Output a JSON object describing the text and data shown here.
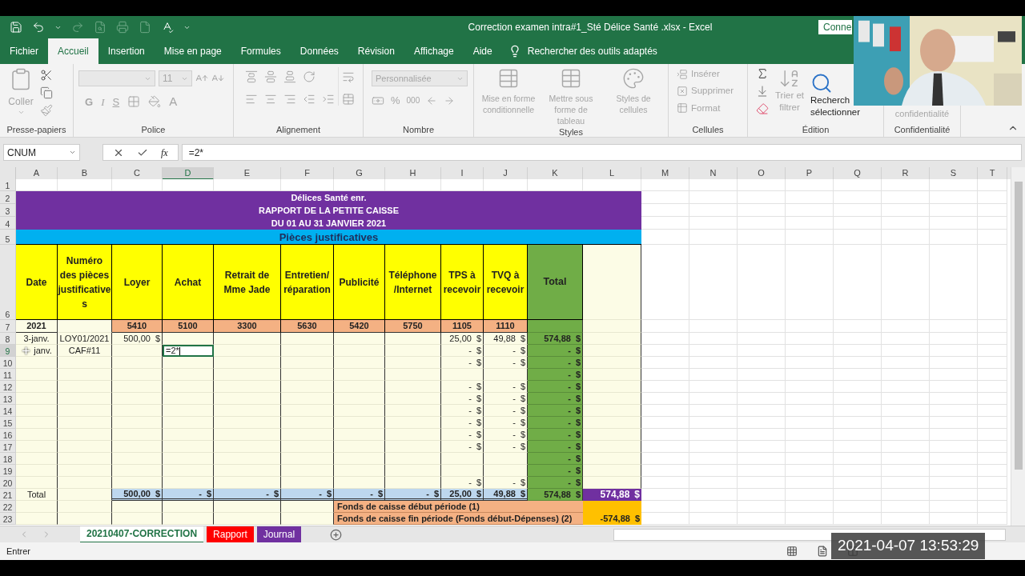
{
  "window": {
    "title": "Correction examen intra#1_Sté Délice Santé .xlsx  -  Excel",
    "connect_button": "Conne"
  },
  "menu_tabs": [
    {
      "label": "Fichier",
      "selected": false
    },
    {
      "label": "Accueil",
      "selected": true
    },
    {
      "label": "Insertion",
      "selected": false
    },
    {
      "label": "Mise en page",
      "selected": false
    },
    {
      "label": "Formules",
      "selected": false
    },
    {
      "label": "Données",
      "selected": false
    },
    {
      "label": "Révision",
      "selected": false
    },
    {
      "label": "Affichage",
      "selected": false
    },
    {
      "label": "Aide",
      "selected": false
    }
  ],
  "tell_me": "Rechercher des outils adaptés",
  "ribbon": {
    "groups": [
      {
        "kind": "clipboard",
        "label": "Presse-papiers",
        "paste": "Coller"
      },
      {
        "kind": "font",
        "label": "Police",
        "size": "11",
        "bold": "G",
        "italic": "I",
        "underline": "S",
        "font_color": "A"
      },
      {
        "kind": "alignment",
        "label": "Alignement"
      },
      {
        "kind": "number",
        "label": "Nombre",
        "format": "Personnalisée",
        "percent": "%",
        "thousands": "000"
      },
      {
        "kind": "styles",
        "label": "Styles",
        "buttons": [
          "Mise en forme conditionnelle",
          "Mettre sous forme de tableau",
          "Styles de cellules"
        ]
      },
      {
        "kind": "cells",
        "label": "Cellules",
        "buttons": [
          "Insérer",
          "Supprimer",
          "Format"
        ]
      },
      {
        "kind": "editing",
        "label": "Édition",
        "sort": "Trier et filtrer",
        "find": [
          "Recherch",
          "sélectionner"
        ]
      },
      {
        "kind": "privacy",
        "label": "Confidentialité",
        "button": "confidentialité"
      }
    ]
  },
  "formula_bar": {
    "name_box": "CNUM",
    "fx": "fx",
    "formula": "=2*"
  },
  "columns": [
    {
      "label": "A",
      "selected": false
    },
    {
      "label": "B",
      "selected": false
    },
    {
      "label": "C",
      "selected": false
    },
    {
      "label": "D",
      "selected": true
    },
    {
      "label": "E",
      "selected": false
    },
    {
      "label": "F",
      "selected": false
    },
    {
      "label": "G",
      "selected": false
    },
    {
      "label": "H",
      "selected": false
    },
    {
      "label": "I",
      "selected": false
    },
    {
      "label": "J",
      "selected": false
    },
    {
      "label": "K",
      "selected": false
    },
    {
      "label": "L",
      "selected": false
    },
    {
      "label": "M",
      "selected": false
    },
    {
      "label": "N",
      "selected": false
    },
    {
      "label": "O",
      "selected": false
    },
    {
      "label": "P",
      "selected": false
    },
    {
      "label": "Q",
      "selected": false
    },
    {
      "label": "R",
      "selected": false
    },
    {
      "label": "S",
      "selected": false
    },
    {
      "label": "T",
      "selected": false
    }
  ],
  "rows": [
    {
      "number": "1",
      "selected": false,
      "kind": "blank"
    },
    {
      "number": "2",
      "selected": false,
      "kind": "title",
      "text": "Délices Santé enr."
    },
    {
      "number": "3",
      "selected": false,
      "kind": "title",
      "text": "RAPPORT DE LA PETITE CAISSE"
    },
    {
      "number": "4",
      "selected": false,
      "kind": "title",
      "text": "DU 01 AU 31 JANVIER 2021"
    },
    {
      "number": "5",
      "selected": false,
      "kind": "band",
      "text": "Pièces justificatives"
    },
    {
      "number": "6",
      "selected": false,
      "kind": "table",
      "cells": [
        {
          "kind": "head",
          "text": "Date"
        },
        {
          "kind": "head",
          "text": "Numéro des pièces justificatives"
        },
        {
          "kind": "head",
          "text": "Loyer"
        },
        {
          "kind": "head",
          "text": "Achat"
        },
        {
          "kind": "head",
          "text": "Retrait de Mme Jade"
        },
        {
          "kind": "head",
          "text": "Entretien/ réparation"
        },
        {
          "kind": "head",
          "text": "Publicité"
        },
        {
          "kind": "head",
          "text": "Téléphone /Internet"
        },
        {
          "kind": "head",
          "text": "TPS à recevoir"
        },
        {
          "kind": "head",
          "text": "TVQ à recevoir"
        },
        {
          "kind": "head_total",
          "text": "Total"
        },
        {
          "kind": "pale"
        }
      ]
    },
    {
      "number": "7",
      "selected": false,
      "kind": "table",
      "cells": [
        {
          "kind": "year",
          "text": "2021"
        },
        {
          "kind": "pale"
        },
        {
          "kind": "code",
          "text": "5410"
        },
        {
          "kind": "code",
          "text": "5100"
        },
        {
          "kind": "code",
          "text": "3300"
        },
        {
          "kind": "code",
          "text": "5630"
        },
        {
          "kind": "code",
          "text": "5420"
        },
        {
          "kind": "code",
          "text": "5750"
        },
        {
          "kind": "code",
          "text": "1105"
        },
        {
          "kind": "code",
          "text": "1110"
        },
        {
          "kind": "green"
        },
        {
          "kind": "pale"
        }
      ]
    },
    {
      "number": "8",
      "selected": false,
      "kind": "table",
      "cells": [
        {
          "kind": "pale",
          "text": "3-janv."
        },
        {
          "kind": "pale",
          "text": "LOY01/2021"
        },
        {
          "kind": "num",
          "value": "500,00",
          "unit": "$"
        },
        {
          "kind": "pale"
        },
        {
          "kind": "pale"
        },
        {
          "kind": "pale"
        },
        {
          "kind": "pale"
        },
        {
          "kind": "pale"
        },
        {
          "kind": "num",
          "value": "25,00",
          "unit": "$"
        },
        {
          "kind": "num",
          "value": "49,88",
          "unit": "$"
        },
        {
          "kind": "green",
          "value": "574,88",
          "unit": "$"
        },
        {
          "kind": "pale"
        }
      ]
    },
    {
      "number": "9",
      "selected": true,
      "kind": "table",
      "cells": [
        {
          "kind": "pale",
          "text": "janv.",
          "pointer": true
        },
        {
          "kind": "pale",
          "text": "CAF#11"
        },
        {
          "kind": "pale"
        },
        {
          "kind": "edit",
          "text": "=2*"
        },
        {
          "kind": "pale"
        },
        {
          "kind": "pale"
        },
        {
          "kind": "pale"
        },
        {
          "kind": "pale"
        },
        {
          "kind": "num",
          "value": "-",
          "unit": "$"
        },
        {
          "kind": "num",
          "value": "-",
          "unit": "$"
        },
        {
          "kind": "green",
          "value": "-",
          "unit": "$"
        },
        {
          "kind": "pale"
        }
      ]
    },
    {
      "number": "10",
      "selected": false,
      "kind": "table",
      "cells": [
        {
          "kind": "pale"
        },
        {
          "kind": "pale"
        },
        {
          "kind": "pale"
        },
        {
          "kind": "pale"
        },
        {
          "kind": "pale"
        },
        {
          "kind": "pale"
        },
        {
          "kind": "pale"
        },
        {
          "kind": "pale"
        },
        {
          "kind": "num",
          "value": "-",
          "unit": "$"
        },
        {
          "kind": "num",
          "value": "-",
          "unit": "$"
        },
        {
          "kind": "green",
          "value": "-",
          "unit": "$"
        },
        {
          "kind": "pale"
        }
      ]
    },
    {
      "number": "11",
      "selected": false,
      "kind": "table",
      "cells": [
        {
          "kind": "pale"
        },
        {
          "kind": "pale"
        },
        {
          "kind": "pale"
        },
        {
          "kind": "pale"
        },
        {
          "kind": "pale"
        },
        {
          "kind": "pale"
        },
        {
          "kind": "pale"
        },
        {
          "kind": "pale"
        },
        {
          "kind": "pale"
        },
        {
          "kind": "pale"
        },
        {
          "kind": "green",
          "value": "-",
          "unit": "$"
        },
        {
          "kind": "pale"
        }
      ]
    },
    {
      "number": "12",
      "selected": false,
      "kind": "table",
      "cells": [
        {
          "kind": "pale"
        },
        {
          "kind": "pale"
        },
        {
          "kind": "pale"
        },
        {
          "kind": "pale"
        },
        {
          "kind": "pale"
        },
        {
          "kind": "pale"
        },
        {
          "kind": "pale"
        },
        {
          "kind": "pale"
        },
        {
          "kind": "num",
          "value": "-",
          "unit": "$"
        },
        {
          "kind": "num",
          "value": "-",
          "unit": "$"
        },
        {
          "kind": "green",
          "value": "-",
          "unit": "$"
        },
        {
          "kind": "pale"
        }
      ]
    },
    {
      "number": "13",
      "selected": false,
      "kind": "table",
      "cells": [
        {
          "kind": "pale"
        },
        {
          "kind": "pale"
        },
        {
          "kind": "pale"
        },
        {
          "kind": "pale"
        },
        {
          "kind": "pale"
        },
        {
          "kind": "pale"
        },
        {
          "kind": "pale"
        },
        {
          "kind": "pale"
        },
        {
          "kind": "num",
          "value": "-",
          "unit": "$"
        },
        {
          "kind": "num",
          "value": "-",
          "unit": "$"
        },
        {
          "kind": "green",
          "value": "-",
          "unit": "$"
        },
        {
          "kind": "pale"
        }
      ]
    },
    {
      "number": "14",
      "selected": false,
      "kind": "table",
      "cells": [
        {
          "kind": "pale"
        },
        {
          "kind": "pale"
        },
        {
          "kind": "pale"
        },
        {
          "kind": "pale"
        },
        {
          "kind": "pale"
        },
        {
          "kind": "pale"
        },
        {
          "kind": "pale"
        },
        {
          "kind": "pale"
        },
        {
          "kind": "num",
          "value": "-",
          "unit": "$"
        },
        {
          "kind": "num",
          "value": "-",
          "unit": "$"
        },
        {
          "kind": "green",
          "value": "-",
          "unit": "$"
        },
        {
          "kind": "pale"
        }
      ]
    },
    {
      "number": "15",
      "selected": false,
      "kind": "table",
      "cells": [
        {
          "kind": "pale"
        },
        {
          "kind": "pale"
        },
        {
          "kind": "pale"
        },
        {
          "kind": "pale"
        },
        {
          "kind": "pale"
        },
        {
          "kind": "pale"
        },
        {
          "kind": "pale"
        },
        {
          "kind": "pale"
        },
        {
          "kind": "num",
          "value": "-",
          "unit": "$"
        },
        {
          "kind": "num",
          "value": "-",
          "unit": "$"
        },
        {
          "kind": "green",
          "value": "-",
          "unit": "$"
        },
        {
          "kind": "pale"
        }
      ]
    },
    {
      "number": "16",
      "selected": false,
      "kind": "table",
      "cells": [
        {
          "kind": "pale"
        },
        {
          "kind": "pale"
        },
        {
          "kind": "pale"
        },
        {
          "kind": "pale"
        },
        {
          "kind": "pale"
        },
        {
          "kind": "pale"
        },
        {
          "kind": "pale"
        },
        {
          "kind": "pale"
        },
        {
          "kind": "num",
          "value": "-",
          "unit": "$"
        },
        {
          "kind": "num",
          "value": "-",
          "unit": "$"
        },
        {
          "kind": "green",
          "value": "-",
          "unit": "$"
        },
        {
          "kind": "pale"
        }
      ]
    },
    {
      "number": "17",
      "selected": false,
      "kind": "table",
      "cells": [
        {
          "kind": "pale"
        },
        {
          "kind": "pale"
        },
        {
          "kind": "pale"
        },
        {
          "kind": "pale"
        },
        {
          "kind": "pale"
        },
        {
          "kind": "pale"
        },
        {
          "kind": "pale"
        },
        {
          "kind": "pale"
        },
        {
          "kind": "num",
          "value": "-",
          "unit": "$"
        },
        {
          "kind": "num",
          "value": "-",
          "unit": "$"
        },
        {
          "kind": "green",
          "value": "-",
          "unit": "$"
        },
        {
          "kind": "pale"
        }
      ]
    },
    {
      "number": "18",
      "selected": false,
      "kind": "table",
      "cells": [
        {
          "kind": "pale"
        },
        {
          "kind": "pale"
        },
        {
          "kind": "pale"
        },
        {
          "kind": "pale"
        },
        {
          "kind": "pale"
        },
        {
          "kind": "pale"
        },
        {
          "kind": "pale"
        },
        {
          "kind": "pale"
        },
        {
          "kind": "pale"
        },
        {
          "kind": "pale"
        },
        {
          "kind": "green",
          "value": "-",
          "unit": "$"
        },
        {
          "kind": "pale"
        }
      ]
    },
    {
      "number": "19",
      "selected": false,
      "kind": "table",
      "cells": [
        {
          "kind": "pale"
        },
        {
          "kind": "pale"
        },
        {
          "kind": "pale"
        },
        {
          "kind": "pale"
        },
        {
          "kind": "pale"
        },
        {
          "kind": "pale"
        },
        {
          "kind": "pale"
        },
        {
          "kind": "pale"
        },
        {
          "kind": "pale"
        },
        {
          "kind": "pale"
        },
        {
          "kind": "green",
          "value": "-",
          "unit": "$"
        },
        {
          "kind": "pale"
        }
      ]
    },
    {
      "number": "20",
      "selected": false,
      "kind": "table",
      "cells": [
        {
          "kind": "pale"
        },
        {
          "kind": "pale"
        },
        {
          "kind": "pale"
        },
        {
          "kind": "pale"
        },
        {
          "kind": "pale"
        },
        {
          "kind": "pale"
        },
        {
          "kind": "pale"
        },
        {
          "kind": "pale"
        },
        {
          "kind": "num",
          "value": "-",
          "unit": "$"
        },
        {
          "kind": "num",
          "value": "-",
          "unit": "$"
        },
        {
          "kind": "green",
          "value": "-",
          "unit": "$"
        },
        {
          "kind": "pale"
        }
      ]
    },
    {
      "number": "21",
      "selected": false,
      "kind": "table",
      "cells": [
        {
          "kind": "pale",
          "text": "Total"
        },
        {
          "kind": "pale"
        },
        {
          "kind": "sum",
          "value": "500,00",
          "unit": "$"
        },
        {
          "kind": "sum",
          "value": "-",
          "unit": "$"
        },
        {
          "kind": "sum",
          "value": "-",
          "unit": "$"
        },
        {
          "kind": "sum",
          "value": "-",
          "unit": "$"
        },
        {
          "kind": "sum",
          "value": "-",
          "unit": "$"
        },
        {
          "kind": "sum",
          "value": "-",
          "unit": "$"
        },
        {
          "kind": "sum",
          "value": "25,00",
          "unit": "$"
        },
        {
          "kind": "sum",
          "value": "49,88",
          "unit": "$"
        },
        {
          "kind": "green",
          "value": "574,88",
          "unit": "$"
        },
        {
          "kind": "grand",
          "value": "574,88",
          "unit": "$"
        }
      ]
    },
    {
      "number": "22",
      "selected": false,
      "kind": "table",
      "cells": [
        {
          "kind": "pale"
        },
        {
          "kind": "pale"
        },
        {
          "kind": "pale"
        },
        {
          "kind": "pale"
        },
        {
          "kind": "pale"
        },
        {
          "kind": "pale"
        },
        {
          "kind": "fund",
          "text": "Fonds de caisse début période (1)"
        },
        {
          "kind": "fund_value"
        }
      ]
    },
    {
      "number": "23",
      "selected": false,
      "kind": "table",
      "cells": [
        {
          "kind": "pale"
        },
        {
          "kind": "pale"
        },
        {
          "kind": "pale"
        },
        {
          "kind": "pale"
        },
        {
          "kind": "pale"
        },
        {
          "kind": "pale"
        },
        {
          "kind": "fund",
          "text": "Fonds de caisse fin période (Fonds début-Dépenses) (2)"
        },
        {
          "kind": "fund_value",
          "value": "-574,88",
          "unit": "$"
        }
      ]
    }
  ],
  "sheet_tabs": [
    {
      "label": "20210407-CORRECTION",
      "selected": true,
      "color": "#ffffff"
    },
    {
      "label": "Rapport",
      "selected": false,
      "color": "#ff0000"
    },
    {
      "label": "Journal",
      "selected": false,
      "color": "#7030a0"
    }
  ],
  "status": "Entrer",
  "recording_timestamp": "2021-04-07 13:53:29"
}
